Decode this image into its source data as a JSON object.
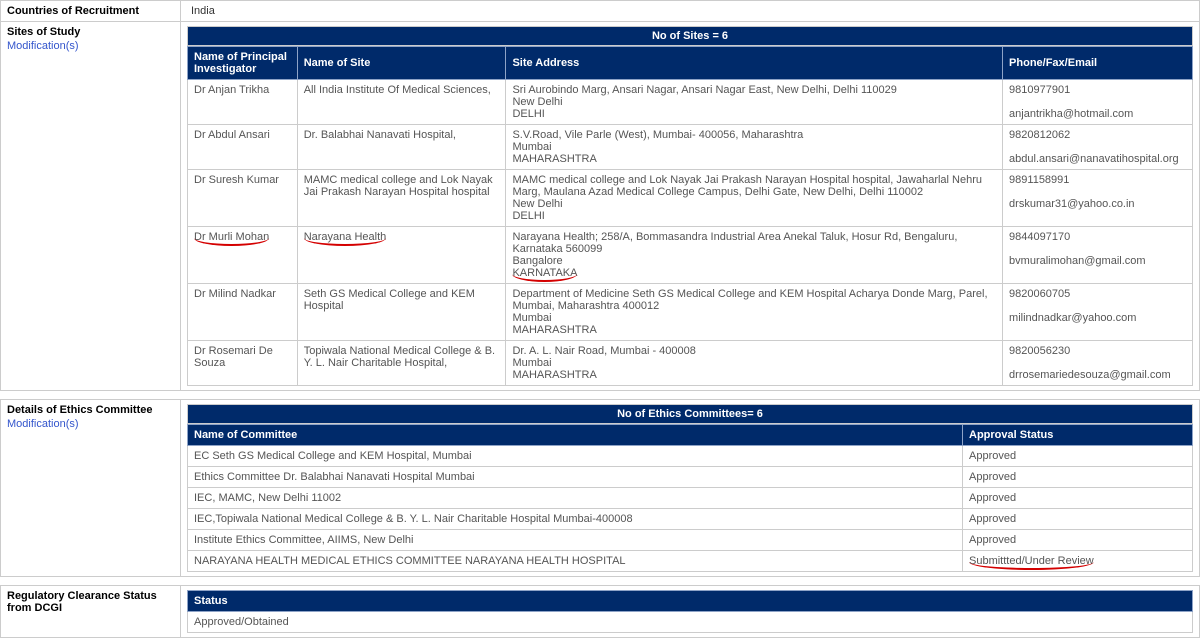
{
  "countries": {
    "label": "Countries of Recruitment",
    "value": "India"
  },
  "sites": {
    "label": "Sites of Study",
    "mod_link": "Modification(s)",
    "header": "No of Sites = 6",
    "cols": {
      "pi": "Name of Principal Investigator",
      "site": "Name of Site",
      "addr": "Site Address",
      "contact": "Phone/Fax/Email"
    },
    "rows": [
      {
        "pi": "Dr Anjan Trikha",
        "site": "All India Institute Of Medical Sciences,",
        "addr": "Sri Aurobindo Marg, Ansari Nagar, Ansari Nagar East, New Delhi, Delhi 110029\nNew Delhi\nDELHI",
        "phone": "9810977901",
        "email": "anjantrikha@hotmail.com"
      },
      {
        "pi": "Dr Abdul Ansari",
        "site": "Dr. Balabhai Nanavati Hospital,",
        "addr": "S.V.Road, Vile Parle (West), Mumbai- 400056, Maharashtra\nMumbai\nMAHARASHTRA",
        "phone": "9820812062",
        "email": "abdul.ansari@nanavatihospital.org"
      },
      {
        "pi": "Dr Suresh Kumar",
        "site": "MAMC medical college and Lok Nayak Jai Prakash Narayan Hospital hospital",
        "addr": "MAMC medical college and Lok Nayak Jai Prakash Narayan Hospital hospital, Jawaharlal Nehru Marg, Maulana Azad Medical College Campus, Delhi Gate, New Delhi, Delhi 110002\nNew Delhi\nDELHI",
        "phone": "9891158991",
        "email": "drskumar31@yahoo.co.in"
      },
      {
        "pi": "Dr Murli Mohan",
        "site": "Narayana Health",
        "addr_l1": "Narayana Health; 258/A, Bommasandra Industrial Area Anekal Taluk, Hosur Rd, Bengaluru, Karnataka 560099",
        "addr_l2": "Bangalore",
        "addr_l3": "KARNATAKA",
        "phone": "9844097170",
        "email": "bvmuralimohan@gmail.com"
      },
      {
        "pi": "Dr Milind Nadkar",
        "site": "Seth GS Medical College and KEM Hospital",
        "addr": "Department of Medicine Seth GS Medical College and KEM Hospital Acharya Donde Marg, Parel, Mumbai, Maharashtra 400012\nMumbai\nMAHARASHTRA",
        "phone": "9820060705",
        "email": "milindnadkar@yahoo.com"
      },
      {
        "pi": "Dr Rosemari De Souza",
        "site": "Topiwala National Medical College & B. Y. L. Nair Charitable Hospital,",
        "addr": "Dr. A. L. Nair Road, Mumbai - 400008\nMumbai\nMAHARASHTRA",
        "phone": "9820056230",
        "email": "drrosemariedesouza@gmail.com"
      }
    ]
  },
  "ethics": {
    "label": "Details of Ethics Committee",
    "mod_link": "Modification(s)",
    "header": "No of Ethics Committees= 6",
    "cols": {
      "name": "Name of Committee",
      "status": "Approval Status"
    },
    "rows": [
      {
        "name": "EC Seth GS Medical College and KEM Hospital, Mumbai",
        "status": "Approved"
      },
      {
        "name": "Ethics Committee Dr. Balabhai Nanavati Hospital Mumbai",
        "status": "Approved"
      },
      {
        "name": "IEC, MAMC, New Delhi 11002",
        "status": "Approved"
      },
      {
        "name": "IEC,Topiwala National Medical College & B. Y. L. Nair Charitable Hospital Mumbai-400008",
        "status": "Approved"
      },
      {
        "name": "Institute Ethics Committee, AIIMS, New Delhi",
        "status": "Approved"
      },
      {
        "name": "NARAYANA HEALTH MEDICAL ETHICS COMMITTEE NARAYANA HEALTH HOSPITAL",
        "status": "Submittted/Under Review"
      }
    ]
  },
  "regulatory": {
    "label": "Regulatory Clearance Status from DCGI",
    "cols": {
      "status": "Status"
    },
    "value": "Approved/Obtained"
  }
}
